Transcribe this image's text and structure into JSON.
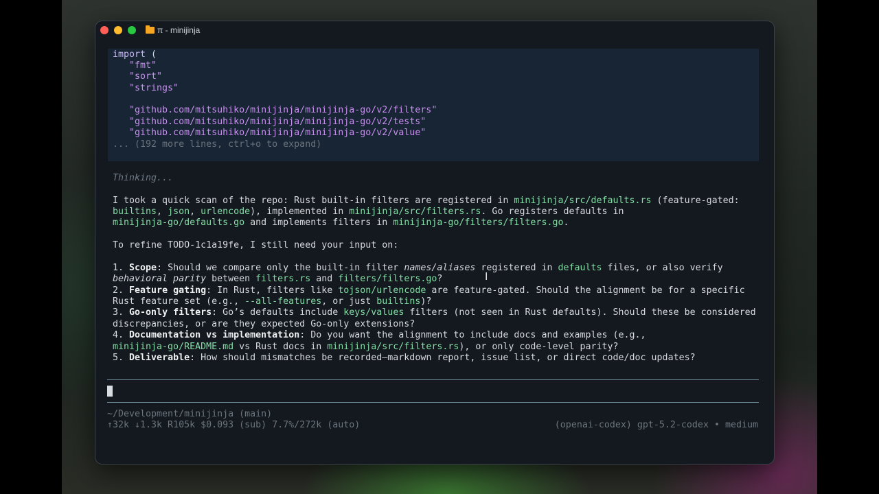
{
  "window": {
    "title": "π - minijinja"
  },
  "code": {
    "lines": [
      {
        "kw": "import",
        "rest": " ("
      },
      {
        "str": "   \"fmt\""
      },
      {
        "str": "   \"sort\""
      },
      {
        "str": "   \"strings\""
      },
      {
        "str": ""
      },
      {
        "str": "   \"github.com/mitsuhiko/minijinja/minijinja-go/v2/filters\""
      },
      {
        "str": "   \"github.com/mitsuhiko/minijinja/minijinja-go/v2/tests\""
      },
      {
        "str": "   \"github.com/mitsuhiko/minijinja/minijinja-go/v2/value\""
      }
    ],
    "more": "... (192 more lines, ctrl+o to expand)"
  },
  "thinking": "Thinking...",
  "message": {
    "p1": {
      "a": "I took a quick scan of the repo: Rust built-in filters are registered in ",
      "c1": "minijinja/src/defaults.rs",
      "b": " (feature-gated:",
      "c2": "builtins",
      "d": ", ",
      "c3": "json",
      "e": ", ",
      "c4": "urlencode",
      "f": "), implemented in ",
      "c5": "minijinja/src/filters.rs",
      "g": ". Go registers defaults in",
      "c6": "minijinja-go/defaults.go",
      "h": " and implements filters in ",
      "c7": "minijinja-go/filters/filters.go",
      "j": "."
    },
    "p2": "To refine TODO-1c1a19fe, I still need your input on:",
    "q1": {
      "num": "1. ",
      "title": "Scope",
      "a": ": Should we compare only the built-in filter ",
      "em": "names/aliases",
      "b": " registered in ",
      "c1": "defaults",
      "c": " files, or also verify",
      "em2": "behavioral parity",
      "d": " between ",
      "c2": "filters.rs",
      "e": " and ",
      "c3": "filters/filters.go",
      "f": "?"
    },
    "q2": {
      "num": "2. ",
      "title": "Feature gating",
      "a": ": In Rust, filters like ",
      "c1": "tojson/urlencode",
      "b": " are feature-gated. Should the alignment be for a specific",
      "c": "Rust feature set (e.g., ",
      "c2": "--all-features",
      "d": ", or just ",
      "c3": "builtins",
      "e": ")?"
    },
    "q3": {
      "num": "3. ",
      "title": "Go-only filters",
      "a": ": Go’s defaults include ",
      "c1": "keys/values",
      "b": " filters (not seen in Rust defaults). Should these be considered",
      "c": "discrepancies, or are they expected Go-only extensions?"
    },
    "q4": {
      "num": "4. ",
      "title": "Documentation vs implementation",
      "a": ": Do you want the alignment to include docs and examples (e.g.,",
      "c1": "minijinja-go/README.md",
      "b": " vs Rust docs in ",
      "c2": "minijinja/src/filters.rs",
      "c": "), or only code-level parity?"
    },
    "q5": {
      "num": "5. ",
      "title": "Deliverable",
      "a": ": How should mismatches be recorded—markdown report, issue list, or direct code/doc updates?"
    }
  },
  "status": {
    "path": "~/Development/minijinja (main)",
    "stats": "↑32k ↓1.3k R105k $0.093 (sub) 7.7%/272k (auto)",
    "model": "(openai-codex) gpt-5.2-codex • medium"
  },
  "colors": {
    "window_bg": "#14191f",
    "code_bg": "#172535",
    "code_path": "#85dca6",
    "string": "#c890ee",
    "muted": "#6a737c"
  }
}
